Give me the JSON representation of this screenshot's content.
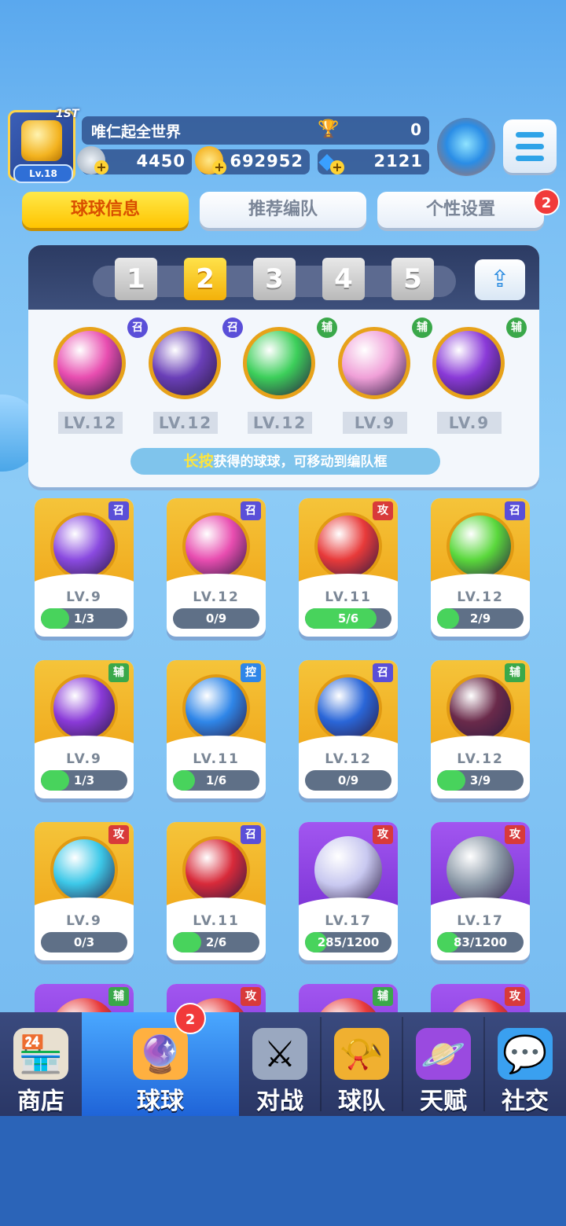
{
  "player": {
    "name": "唯仁起全世界",
    "rank": "1ST",
    "level": "Lv.18",
    "trophies": "0"
  },
  "resources": [
    {
      "icon": "silver-coin-icon",
      "value": "4450"
    },
    {
      "icon": "gold-coin-icon",
      "value": "692952"
    },
    {
      "icon": "diamond-icon",
      "value": "2121"
    }
  ],
  "tabs": [
    {
      "label": "球球信息",
      "active": true
    },
    {
      "label": "推荐编队",
      "active": false
    },
    {
      "label": "个性设置",
      "active": false,
      "badge": "2"
    }
  ],
  "team": {
    "slots": [
      "1",
      "2",
      "3",
      "4",
      "5"
    ],
    "selected_slot": "2",
    "balls": [
      {
        "tag": "召",
        "level": "LV.12",
        "color": "#e84db0"
      },
      {
        "tag": "召",
        "level": "LV.12",
        "color": "#6a3fb8"
      },
      {
        "tag": "辅",
        "level": "LV.12",
        "color": "#3ccf5a"
      },
      {
        "tag": "辅",
        "level": "LV.9",
        "color": "#f0a0d8"
      },
      {
        "tag": "辅",
        "level": "LV.9",
        "color": "#8a3ad8"
      }
    ],
    "hint_highlight": "长按",
    "hint_text": "获得的球球，可移动到编队框"
  },
  "cards": [
    {
      "tag": "召",
      "level": "LV.9",
      "progress": "1/3",
      "fraction": 0.33,
      "style": "gold",
      "color": "#8a4ae0"
    },
    {
      "tag": "召",
      "level": "LV.12",
      "progress": "0/9",
      "fraction": 0.0,
      "style": "gold",
      "color": "#e84db0"
    },
    {
      "tag": "攻",
      "level": "LV.11",
      "progress": "5/6",
      "fraction": 0.83,
      "style": "gold",
      "color": "#e83a3a"
    },
    {
      "tag": "召",
      "level": "LV.12",
      "progress": "2/9",
      "fraction": 0.22,
      "style": "gold",
      "color": "#5ad83c"
    },
    {
      "tag": "辅",
      "level": "LV.9",
      "progress": "1/3",
      "fraction": 0.33,
      "style": "gold",
      "color": "#8a3ad8"
    },
    {
      "tag": "控",
      "level": "LV.11",
      "progress": "1/6",
      "fraction": 0.17,
      "style": "gold",
      "color": "#2f86e8"
    },
    {
      "tag": "召",
      "level": "LV.12",
      "progress": "0/9",
      "fraction": 0.0,
      "style": "gold",
      "color": "#2a66d8"
    },
    {
      "tag": "辅",
      "level": "LV.12",
      "progress": "3/9",
      "fraction": 0.33,
      "style": "gold",
      "color": "#6a2a4a"
    },
    {
      "tag": "攻",
      "level": "LV.9",
      "progress": "0/3",
      "fraction": 0.0,
      "style": "gold",
      "color": "#3cc8e8"
    },
    {
      "tag": "召",
      "level": "LV.11",
      "progress": "2/6",
      "fraction": 0.33,
      "style": "gold",
      "color": "#d82a3a"
    },
    {
      "tag": "攻",
      "level": "LV.17",
      "progress": "285/1200",
      "fraction": 0.24,
      "style": "purple",
      "color": "#c8c8f0"
    },
    {
      "tag": "攻",
      "level": "LV.17",
      "progress": "83/1200",
      "fraction": 0.07,
      "style": "purple",
      "color": "#8c9aa8"
    }
  ],
  "partial_cards": [
    {
      "tag": "辅",
      "style": "purple"
    },
    {
      "tag": "攻",
      "style": "purple"
    },
    {
      "tag": "辅",
      "style": "purple"
    },
    {
      "tag": "攻",
      "style": "purple"
    }
  ],
  "nav": [
    {
      "label": "商店",
      "icon": "shop-icon",
      "active": false
    },
    {
      "label": "球球",
      "icon": "balls-icon",
      "active": true,
      "badge": "2"
    },
    {
      "label": "对战",
      "icon": "crossed-swords-icon",
      "active": false
    },
    {
      "label": "球队",
      "icon": "whistle-icon",
      "active": false
    },
    {
      "label": "天赋",
      "icon": "planet-icon",
      "active": false
    },
    {
      "label": "社交",
      "icon": "chat-heart-icon",
      "active": false
    }
  ],
  "colors": {
    "tag_summon": "#5a4fd8",
    "tag_support": "#3aa84a",
    "tag_attack": "#d83a3a",
    "tag_control": "#2f86e8"
  }
}
